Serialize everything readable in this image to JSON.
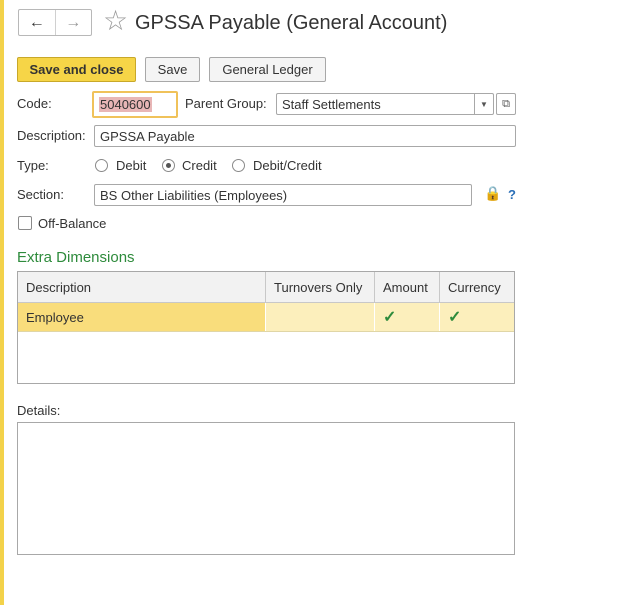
{
  "title": "GPSSA Payable (General Account)",
  "toolbar": {
    "save_close_label": "Save and close",
    "save_label": "Save",
    "general_ledger_label": "General Ledger"
  },
  "form": {
    "code_label": "Code:",
    "code_value": "5040600",
    "parent_group_label": "Parent Group:",
    "parent_group_value": "Staff Settlements",
    "description_label": "Description:",
    "description_value": "GPSSA Payable",
    "type_label": "Type:",
    "type_options": [
      "Debit",
      "Credit",
      "Debit/Credit"
    ],
    "type_selected": "Credit",
    "section_label": "Section:",
    "section_value": "BS Other Liabilities (Employees)",
    "help_text": "?",
    "off_balance_label": "Off-Balance",
    "off_balance_checked": false
  },
  "extra_dimensions": {
    "title": "Extra Dimensions",
    "columns": [
      "Description",
      "Turnovers Only",
      "Amount",
      "Currency"
    ],
    "rows": [
      {
        "description": "Employee",
        "turnovers_only": false,
        "amount": true,
        "currency": true
      }
    ]
  },
  "details": {
    "label": "Details:",
    "value": ""
  },
  "colors": {
    "accent_yellow": "#f6d547",
    "section_green": "#2e8b3c",
    "row_highlight": "#fcefbc"
  }
}
